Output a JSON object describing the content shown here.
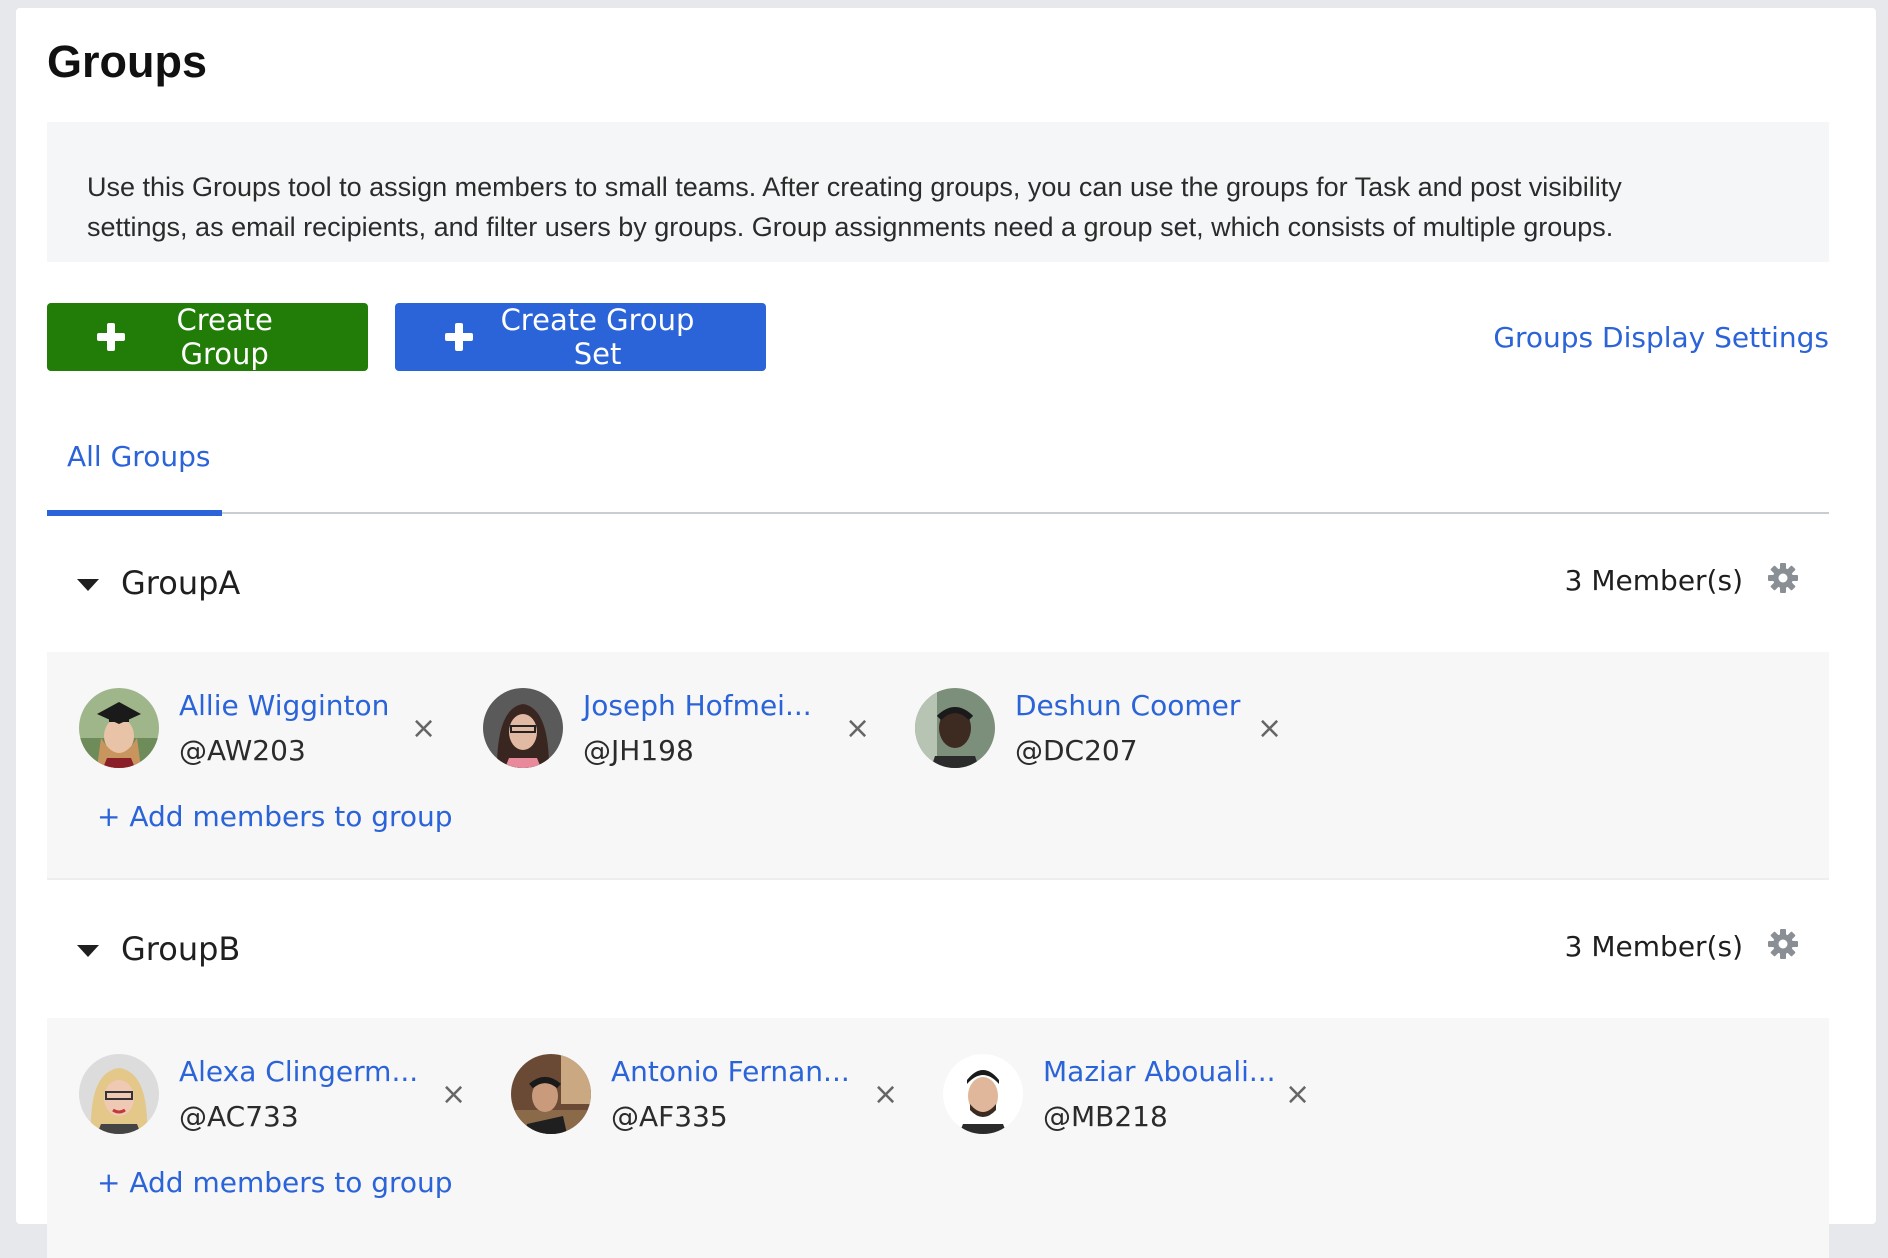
{
  "page": {
    "title": "Groups"
  },
  "info": {
    "line1": "Use this Groups tool to assign members to small teams. After creating groups, you can use the groups for Task and post visibility",
    "line2": "settings, as email recipients, and filter users by groups. Group assignments need a group set, which consists of multiple groups."
  },
  "actions": {
    "create_group": "Create Group",
    "create_group_set": "Create Group Set",
    "display_settings": "Groups Display Settings"
  },
  "tabs": [
    {
      "label": "All Groups"
    }
  ],
  "colors": {
    "primary_blue": "#2b63d8",
    "green": "#217d08"
  },
  "groups": [
    {
      "name": "GroupA",
      "member_count": "3 Member(s)",
      "add_label": "+ Add members to group",
      "members": [
        {
          "name": "Allie Wigginton",
          "handle": "@AW203"
        },
        {
          "name": "Joseph Hofmei...",
          "handle": "@JH198"
        },
        {
          "name": "Deshun Coomer",
          "handle": "@DC207"
        }
      ]
    },
    {
      "name": "GroupB",
      "member_count": "3 Member(s)",
      "add_label": "+ Add members to group",
      "members": [
        {
          "name": "Alexa Clingerm...",
          "handle": "@AC733"
        },
        {
          "name": "Antonio Fernan...",
          "handle": "@AF335"
        },
        {
          "name": "Maziar Abouali...",
          "handle": "@MB218"
        }
      ]
    }
  ],
  "icons": {
    "remove": "×",
    "gear": "gear-icon",
    "caret": "caret-down-icon"
  }
}
